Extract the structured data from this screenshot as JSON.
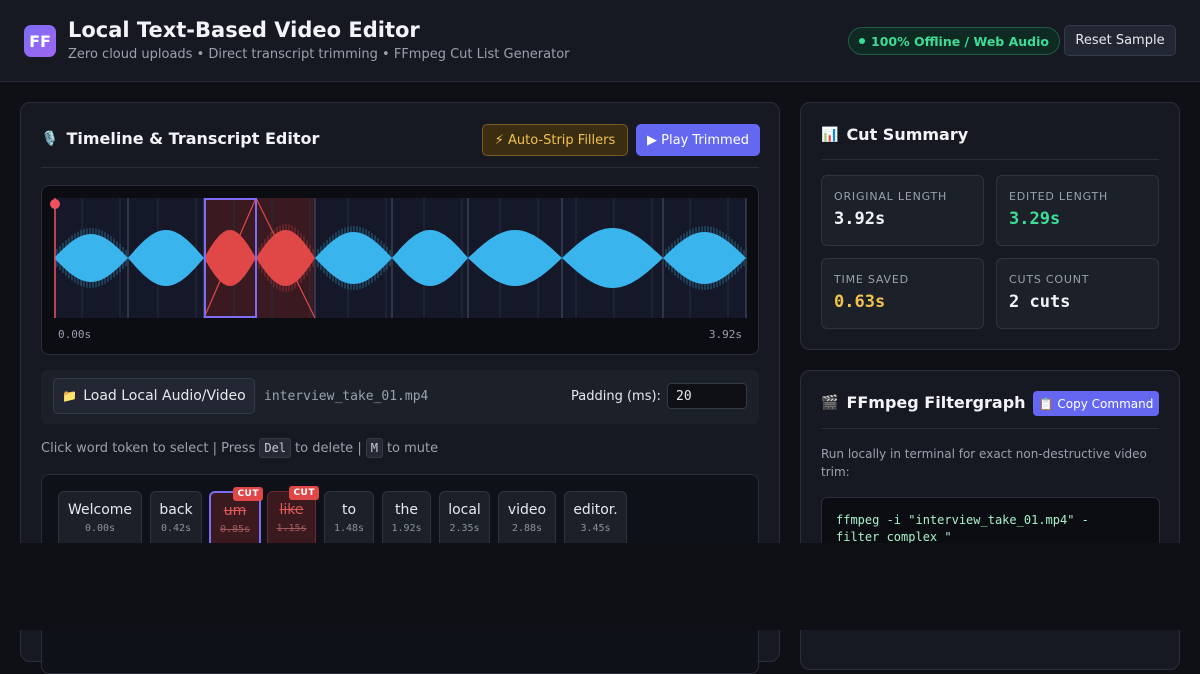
{
  "header": {
    "logo": "FF",
    "title": "Local Text-Based Video Editor",
    "subtitle": "Zero cloud uploads • Direct transcript trimming • FFmpeg Cut List Generator",
    "offline_badge": "100% Offline / Web Audio",
    "reset_label": "Reset Sample"
  },
  "editor": {
    "title": "Timeline & Transcript Editor",
    "icon": "microphone-icon",
    "auto_strip_label": "⚡ Auto-Strip Fillers",
    "play_trimmed_label": "▶ Play Trimmed",
    "waveform": {
      "time_start": "0.00s",
      "time_end": "3.92s",
      "duration": 3.92,
      "colors": {
        "wave": "#3ab4ec",
        "cut": "#e04848",
        "selection": "#7c6cf6",
        "playhead": "#f05060"
      }
    },
    "load_label": "Load Local Audio/Video",
    "file_name": "interview_take_01.mp4",
    "padding_label": "Padding (ms):",
    "padding_value": "20",
    "hint": {
      "prefix": "Click word token to select | Press",
      "key_delete": "Del",
      "middle": "to delete |",
      "key_mute": "M",
      "suffix": "to mute"
    },
    "tokens": [
      {
        "word": "Welcome",
        "time": "0.00s",
        "cut": false,
        "selected": false
      },
      {
        "word": "back",
        "time": "0.42s",
        "cut": false,
        "selected": false
      },
      {
        "word": "um",
        "time": "0.85s",
        "cut": true,
        "selected": true
      },
      {
        "word": "like",
        "time": "1.15s",
        "cut": true,
        "selected": false
      },
      {
        "word": "to",
        "time": "1.48s",
        "cut": false,
        "selected": false
      },
      {
        "word": "the",
        "time": "1.92s",
        "cut": false,
        "selected": false
      },
      {
        "word": "local",
        "time": "2.35s",
        "cut": false,
        "selected": false
      },
      {
        "word": "video",
        "time": "2.88s",
        "cut": false,
        "selected": false
      },
      {
        "word": "editor.",
        "time": "3.45s",
        "cut": false,
        "selected": false
      }
    ],
    "cut_tag": "CUT"
  },
  "summary": {
    "title": "Cut Summary",
    "icon": "bar-chart-icon",
    "original_label": "ORIGINAL LENGTH",
    "original_value": "3.92s",
    "edited_label": "EDITED LENGTH",
    "edited_value": "3.29s",
    "saved_label": "TIME SAVED",
    "saved_value": "0.63s",
    "cuts_label": "CUTS COUNT",
    "cuts_value": "2 cuts",
    "colors": {
      "edited": "#3ddc97",
      "saved": "#f3c14e",
      "default": "#f3f4f8"
    }
  },
  "ffmpeg": {
    "title": "FFmpeg Filtergraph",
    "icon": "clapperboard-icon",
    "copy_label": "📋 Copy Command",
    "description": "Run locally in terminal for exact non-destructive video trim:",
    "command": "ffmpeg -i \"interview_take_01.mp4\" -filter_complex \""
  }
}
